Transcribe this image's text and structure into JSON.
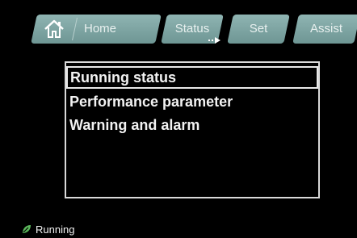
{
  "tabs": [
    {
      "id": "home",
      "label": "Home",
      "icon": "home-icon"
    },
    {
      "id": "status",
      "label": "Status"
    },
    {
      "id": "set",
      "label": "Set"
    },
    {
      "id": "assist",
      "label": "Assist"
    }
  ],
  "menu": {
    "items": [
      {
        "label": "Running status",
        "selected": true
      },
      {
        "label": "Performance parameter",
        "selected": false
      },
      {
        "label": "Warning and alarm",
        "selected": false
      }
    ]
  },
  "statusbar": {
    "icon": "leaf-icon",
    "text": "Running",
    "icon_color": "#5cb85c"
  },
  "colors": {
    "tab_bg": "#7fa6a4",
    "background": "#000000",
    "text": "#f2f2f2"
  }
}
